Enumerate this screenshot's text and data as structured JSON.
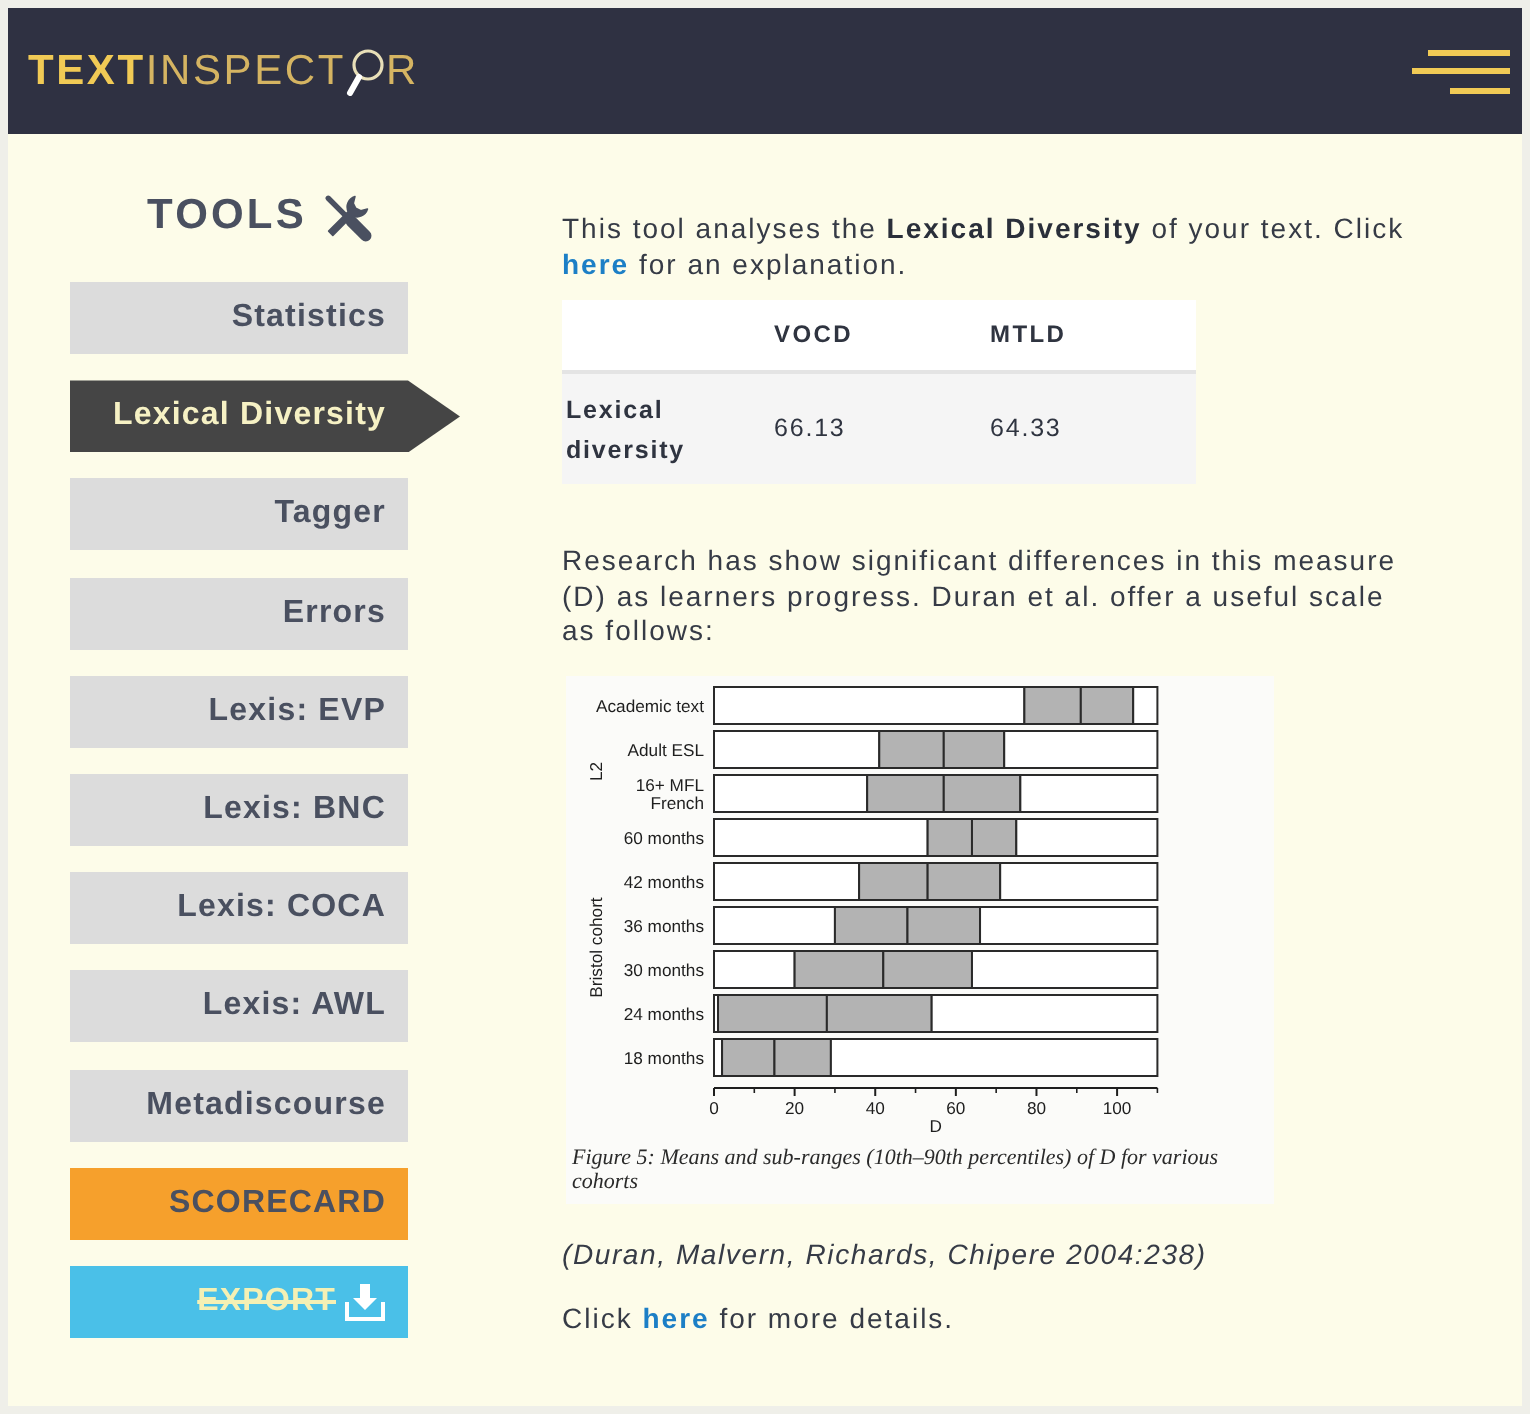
{
  "header": {
    "logo": {
      "text": "**TEXT**INSPECT",
      "tail": "R"
    }
  },
  "sidebar": {
    "heading": "TOOLS",
    "items": [
      {
        "label": "Statistics",
        "kind": "tool",
        "selected": false,
        "disabled": false
      },
      {
        "label": "Lexical Diversity",
        "kind": "tool",
        "selected": true,
        "disabled": false
      },
      {
        "label": "Tagger",
        "kind": "tool",
        "selected": false,
        "disabled": false
      },
      {
        "label": "Errors",
        "kind": "tool",
        "selected": false,
        "disabled": false
      },
      {
        "label": "Lexis: EVP",
        "kind": "tool",
        "selected": false,
        "disabled": false
      },
      {
        "label": "Lexis: BNC",
        "kind": "tool",
        "selected": false,
        "disabled": false
      },
      {
        "label": "Lexis: COCA",
        "kind": "tool",
        "selected": false,
        "disabled": false
      },
      {
        "label": "Lexis: AWL",
        "kind": "tool",
        "selected": false,
        "disabled": false
      },
      {
        "label": "Metadiscourse",
        "kind": "tool",
        "selected": false,
        "disabled": false
      },
      {
        "label": "SCORECARD",
        "kind": "scorecard",
        "selected": false,
        "disabled": false
      },
      {
        "label": "EXPORT",
        "kind": "export",
        "selected": false,
        "disabled": true
      }
    ]
  },
  "content": {
    "intro": {
      "before": "This tool analyses the **Lexical Diversity** of your text. Click ",
      "link": "here",
      "after": " for an explanation."
    },
    "table": {
      "columns": [
        "VOCD",
        "MTLD"
      ],
      "rows": [
        {
          "label": "Lexical diversity",
          "cells": [
            "66.13",
            "64.33"
          ]
        }
      ]
    },
    "research": "Research has show significant differences in this measure (D) as learners progress. Duran et al. offer a useful scale as follows:",
    "figure": {
      "chart_data": {
        "type": "bar",
        "orientation": "horizontal",
        "stacked": true,
        "xlabel": "D",
        "categories": [
          "Academic text",
          "Adult ESL",
          "16+ MFL\nFrench",
          "60 months",
          "42 months",
          "36 months",
          "30 months",
          "24 months",
          "18 months"
        ],
        "series": [
          {
            "color": "#ffffff",
            "values": [
              77,
              41,
              38,
              53,
              36,
              30,
              20,
              1,
              2
            ]
          },
          {
            "color": "#b3b3b3",
            "values": [
              14,
              16,
              19,
              11,
              17,
              18,
              22,
              27,
              13
            ]
          },
          {
            "color": "#b3b3b3",
            "values": [
              13,
              15,
              19,
              11,
              18,
              18,
              22,
              26,
              14
            ]
          },
          {
            "color": "#ffffff",
            "values": [
              6,
              38,
              34,
              35,
              39,
              44,
              46,
              56,
              81
            ]
          }
        ],
        "xlim": [
          0,
          110
        ],
        "xticks": [
          0,
          20,
          40,
          60,
          80,
          100
        ],
        "annotations": [
          "L2",
          "Bristol cohort"
        ]
      },
      "caption": "Figure 5: Means and sub-ranges (10th–90th percentiles) of D for various cohorts"
    },
    "citation": "(Duran, Malvern, Richards, Chipere 2004:238)",
    "more": {
      "before": "Click ",
      "link": "here",
      "after": " for more details."
    }
  }
}
